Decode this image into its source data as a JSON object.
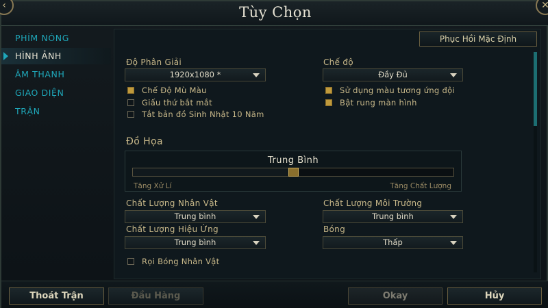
{
  "window": {
    "title": "Tùy Chọn"
  },
  "sidebar": {
    "items": [
      {
        "label": "PHÍM NÓNG"
      },
      {
        "label": "HÌNH ẢNH"
      },
      {
        "label": "ÂM THANH"
      },
      {
        "label": "GIAO DIỆN"
      },
      {
        "label": "TRẬN"
      }
    ],
    "active": "HÌNH ẢNH"
  },
  "toolbar": {
    "reset_label": "Phục Hồi Mặc Định"
  },
  "resolution": {
    "label": "Độ Phân Giải",
    "value": "1920x1080 *"
  },
  "window_mode": {
    "label": "Chế độ",
    "value": "Đầy Đủ"
  },
  "checkboxes": [
    {
      "label": "Chế Độ Mù Màu",
      "checked": true
    },
    {
      "label": "Giấu thứ bắt mắt",
      "checked": false
    },
    {
      "label": "Tắt bản đồ Sinh Nhật 10 Năm",
      "checked": false
    },
    {
      "label": "Sử dụng màu tương ứng đội",
      "checked": true
    },
    {
      "label": "Bật rung màn hình",
      "checked": true
    }
  ],
  "graphics": {
    "section_title": "Đồ Họa",
    "quality_label": "Trung Bình",
    "slider_level": 0.5,
    "min_label": "Tăng Xử Lí",
    "max_label": "Tăng Chất Lượng"
  },
  "dropdowns": [
    {
      "label": "Chất Lượng Nhân Vật",
      "value": "Trung bình"
    },
    {
      "label": "Chất Lượng Môi Trường",
      "value": "Trung bình"
    },
    {
      "label": "Chất Lượng Hiệu Ứng",
      "value": "Trung bình"
    },
    {
      "label": "Bóng",
      "value": "Thấp"
    }
  ],
  "shadow_checkbox": {
    "label": "Rọi Bóng Nhân Vật",
    "checked": false
  },
  "footer": {
    "exit_label": "Thoát Trận",
    "surrender_label": "Đầu Hàng",
    "okay_label": "Okay",
    "cancel_label": "Hủy"
  },
  "colors": {
    "accent": "#1fa7b9",
    "gold": "#c09a3c",
    "background": "#0f181d"
  }
}
